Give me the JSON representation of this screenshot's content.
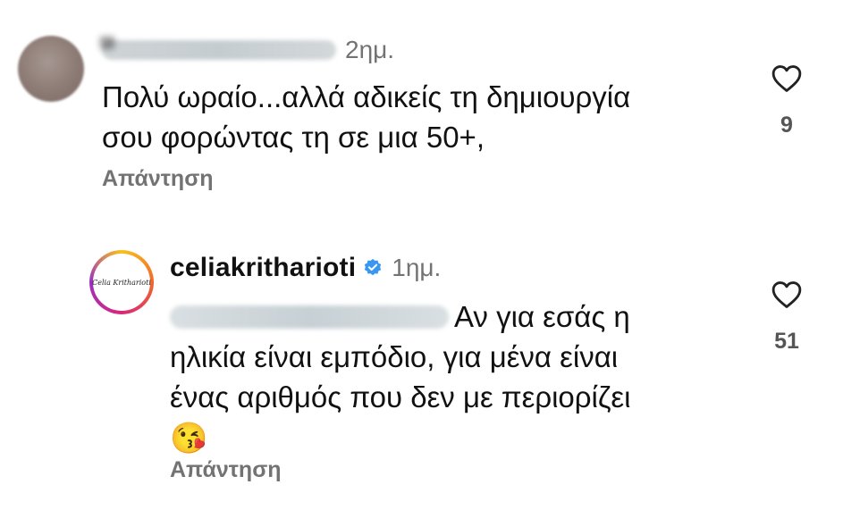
{
  "comments": [
    {
      "username_visible": "",
      "time": "2ημ.",
      "text_lines": [
        "Πολύ ωραίο...αλλά αδικείς τη δημιουργία",
        "σου φορώντας τη σε μια 50+,"
      ],
      "reply_label": "Απάντηση",
      "likes": "9"
    },
    {
      "username": "celiakritharioti",
      "time": "1ημ.",
      "avatar_text": "Celia Kritharioti",
      "text_lines": [
        "Αν για εσάς η",
        "ηλικία είναι εμπόδιο, για μένα είναι",
        "ένας αριθμός που δεν με περιορίζει",
        "😘"
      ],
      "reply_label": "Απάντηση",
      "likes": "51"
    }
  ],
  "colors": {
    "text": "#111111",
    "secondary": "#737373",
    "verified": "#3897f0",
    "heart_outline": "#222222"
  },
  "icons": {
    "like": "heart-outline-icon",
    "verified": "verified-badge-icon"
  }
}
